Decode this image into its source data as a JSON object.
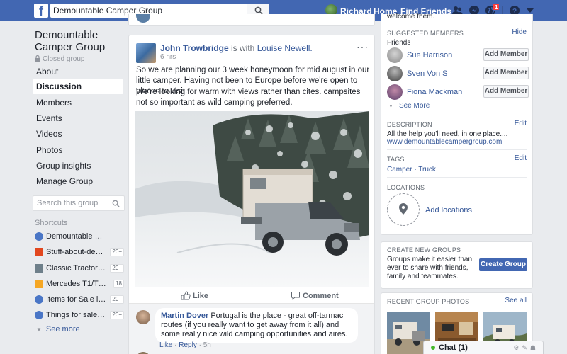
{
  "topbar": {
    "logo": "f",
    "search_value": "Demountable Camper Group",
    "user_name": "Richard",
    "links": [
      "Home",
      "Find Friends"
    ],
    "notifications_count": "1",
    "brand_color": "#4267b2"
  },
  "left": {
    "group_name": "Demountable Camper Group",
    "privacy": "Closed group",
    "nav": [
      "About",
      "Discussion",
      "Members",
      "Events",
      "Videos",
      "Photos",
      "Group insights",
      "Manage Group"
    ],
    "active_nav": "Discussion",
    "search_placeholder": "Search this group",
    "shortcuts_heading": "Shortcuts",
    "shortcuts": [
      {
        "label": "Demountable Camper ...",
        "badge": ""
      },
      {
        "label": "Stuff-about-demo...",
        "badge": "20+"
      },
      {
        "label": "Classic Tractors Fa...",
        "badge": "20+"
      },
      {
        "label": "Mercedes T1/T2 Ap...",
        "badge": "18"
      },
      {
        "label": "Items for Sale in N...",
        "badge": "20+"
      },
      {
        "label": "Things for sale in ...",
        "badge": "20+"
      }
    ],
    "see_more": "See more"
  },
  "post": {
    "author": "John Trowbridge",
    "with_text": "is with",
    "with_name": "Louise Newell.",
    "time": "6 hrs",
    "more": "···",
    "paragraph1": "So we are planning our 3 week honeymoon for mid august in our little camper. Having not been to Europe before we're open to places to visit.",
    "paragraph2": "We're looking for warm with views rather than cites. campsites not so important as wild camping preferred.",
    "like_label": "Like",
    "comment_label": "Comment",
    "comment": {
      "author": "Martin Dover",
      "text": "Portugal is the place - great off-tarmac routes (if you really want to get away from it all) and some really nice wild camping opportunities and aires.",
      "like": "Like",
      "reply": "Reply",
      "time": "5h"
    }
  },
  "right": {
    "top_stub": "welcome them.",
    "suggested_heading": "SUGGESTED MEMBERS",
    "hide": "Hide",
    "friends_label": "Friends",
    "members": [
      {
        "name": "Sue Harrison",
        "button": "Add Member"
      },
      {
        "name": "Sven Von S",
        "button": "Add Member"
      },
      {
        "name": "Fiona Mackman",
        "button": "Add Member"
      }
    ],
    "see_more": "See More",
    "description_heading": "DESCRIPTION",
    "edit": "Edit",
    "description": "All the help you'll need, in one place....",
    "website": "www.demountablecampergroup.com",
    "tags_heading": "TAGS",
    "tags": "Camper · Truck",
    "locations_heading": "LOCATIONS",
    "add_locations": "Add locations",
    "create_heading": "CREATE NEW GROUPS",
    "create_text": "Groups make it easier than ever to share with friends, family and teammates.",
    "create_button": "Create Group",
    "photos_heading": "RECENT GROUP PHOTOS",
    "see_all": "See all"
  },
  "chat": {
    "label": "Chat (1)"
  }
}
